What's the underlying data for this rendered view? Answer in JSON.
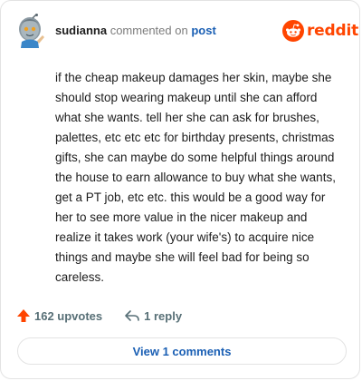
{
  "header": {
    "username": "sudianna",
    "action_text": "commented on",
    "post_link": "post"
  },
  "brand": {
    "name": "reddit",
    "logo_icon": "reddit-snoo-icon",
    "accent_color": "#ff4500"
  },
  "comment": {
    "body": "if the cheap makeup damages her skin, maybe she should stop wearing makeup until she can afford what she wants. tell her she can ask for brushes, palettes, etc etc etc for birthday presents, christmas gifts, she can maybe do some helpful things around the house to earn allowance to buy what she wants, get a PT job, etc etc. this would be a good way for her to see more value in the nicer makeup and realize it takes work (your wife's) to acquire nice things and maybe she will feel bad for being so careless."
  },
  "actions": {
    "upvotes_label": "162 upvotes",
    "upvote_icon": "upvote-arrow-icon",
    "reply_label": "1 reply",
    "reply_icon": "reply-arrow-icon"
  },
  "footer": {
    "view_comments_label": "View 1 comments"
  }
}
